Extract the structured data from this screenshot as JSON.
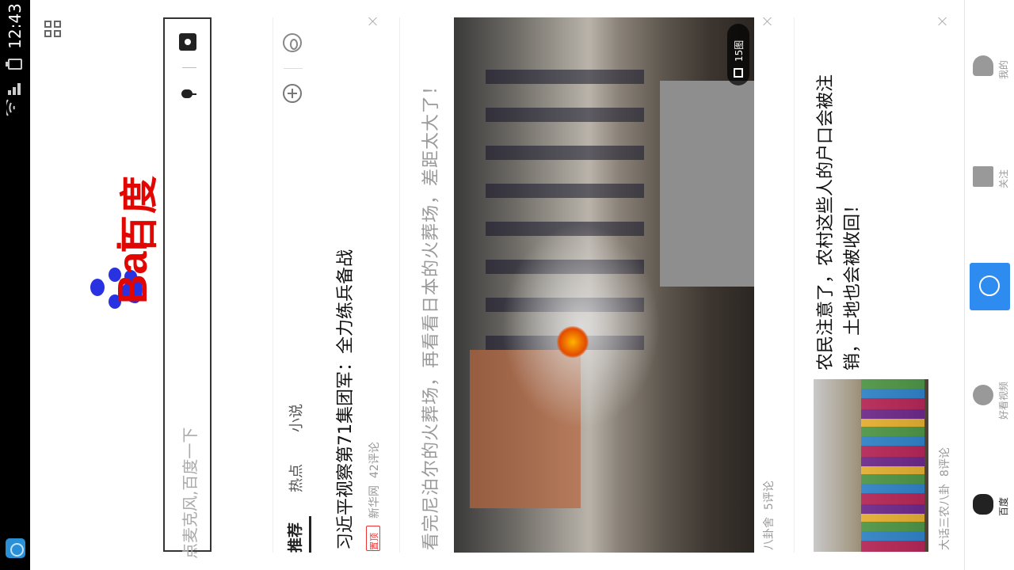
{
  "status_bar": {
    "time": "12:43"
  },
  "header": {
    "logo_text_latin": "Bai",
    "logo_text_cn": "百度"
  },
  "search": {
    "placeholder": "点麦克风,百度一下"
  },
  "tabs": [
    {
      "label": "推荐",
      "active": true
    },
    {
      "label": "热点",
      "active": false
    },
    {
      "label": "小说",
      "active": false
    }
  ],
  "feed": [
    {
      "title": "习近平视察第71集团军：全力练兵备战",
      "pin_label": "置顶",
      "source": "新华网",
      "comments": "42评论"
    },
    {
      "title": "看完尼泊尔的火葬场，再看看日本的火葬场，差距太大了！",
      "image_badge": "15图",
      "source": "八卦舍",
      "comments": "5评论"
    },
    {
      "title_line1": "农民注意了，农村这些人的户口会被注",
      "title_line2": "销，土地也会被收回！",
      "source": "大话三农八卦",
      "comments": "8评论"
    }
  ],
  "nav": [
    {
      "label": "我的",
      "icon": "person-icon"
    },
    {
      "label": "关注",
      "icon": "follow-icon"
    },
    {
      "label": "",
      "icon": "voice-search-icon"
    },
    {
      "label": "好看视频",
      "icon": "video-icon"
    },
    {
      "label": "百度",
      "icon": "baidu-paw-icon"
    }
  ],
  "colors": {
    "brand_red": "#e10601",
    "accent_blue": "#2e8cf0"
  }
}
